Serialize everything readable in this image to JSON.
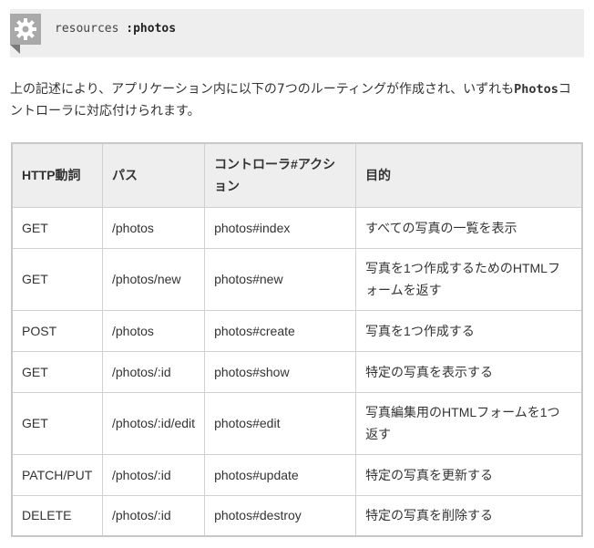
{
  "code": {
    "keyword": "resources ",
    "symbol": ":photos"
  },
  "intro": {
    "text_before": "上の記述により、アプリケーション内に以下の7つのルーティングが作成され、いずれも",
    "controller_name": "Photos",
    "text_after": "コントローラに対応付けられます。"
  },
  "table": {
    "headers": [
      "HTTP動詞",
      "パス",
      "コントローラ#アクション",
      "目的"
    ],
    "rows": [
      [
        "GET",
        "/photos",
        "photos#index",
        "すべての写真の一覧を表示"
      ],
      [
        "GET",
        "/photos/new",
        "photos#new",
        "写真を1つ作成するためのHTMLフォームを返す"
      ],
      [
        "POST",
        "/photos",
        "photos#create",
        "写真を1つ作成する"
      ],
      [
        "GET",
        "/photos/:id",
        "photos#show",
        "特定の写真を表示する"
      ],
      [
        "GET",
        "/photos/:id/edit",
        "photos#edit",
        "写真編集用のHTMLフォームを1つ返す"
      ],
      [
        "PATCH/PUT",
        "/photos/:id",
        "photos#update",
        "特定の写真を更新する"
      ],
      [
        "DELETE",
        "/photos/:id",
        "photos#destroy",
        "特定の写真を削除する"
      ]
    ]
  },
  "icons": {
    "badge": "gear-icon"
  }
}
